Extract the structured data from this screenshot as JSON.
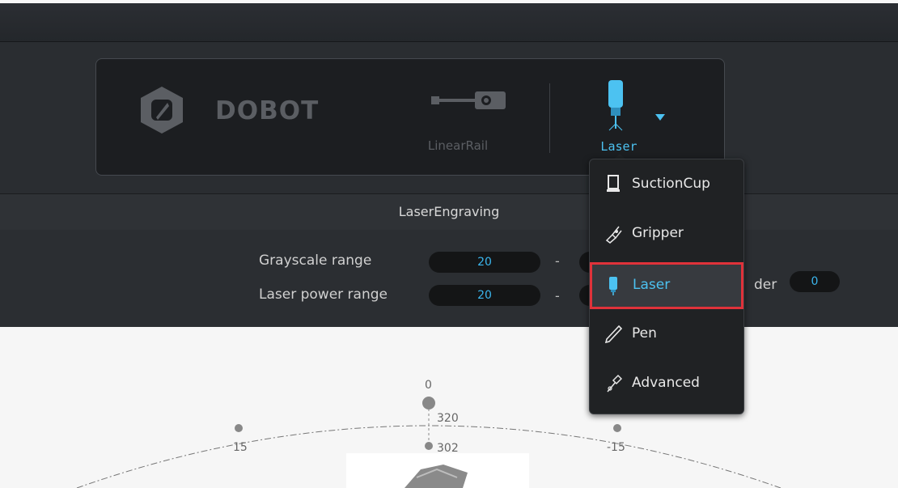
{
  "app": {
    "logo_text": "DOBOT"
  },
  "devices": {
    "rail_label": "LinearRail",
    "current_tool_label": "Laser"
  },
  "section": {
    "title": "LaserEngraving"
  },
  "settings": {
    "grayscale_label": "Grayscale  range",
    "grayscale_min": "20",
    "power_label": "Laser power range",
    "power_min": "20",
    "dash": "-",
    "order_label_partial": "der",
    "order_value": "0"
  },
  "tool_menu": {
    "items": [
      {
        "label": "SuctionCup",
        "icon": "suction-cup-icon"
      },
      {
        "label": "Gripper",
        "icon": "gripper-icon"
      },
      {
        "label": "Laser",
        "icon": "laser-icon",
        "selected": true
      },
      {
        "label": "Pen",
        "icon": "pen-icon"
      },
      {
        "label": "Advanced",
        "icon": "advanced-icon"
      }
    ]
  },
  "workspace": {
    "labels": {
      "center_top": "0",
      "left": "15",
      "right": "-15",
      "r_outer": "320",
      "r_inner": "302"
    }
  },
  "colors": {
    "accent": "#4cc2f1",
    "highlight": "#e0323a",
    "panel": "#1c1e21"
  }
}
